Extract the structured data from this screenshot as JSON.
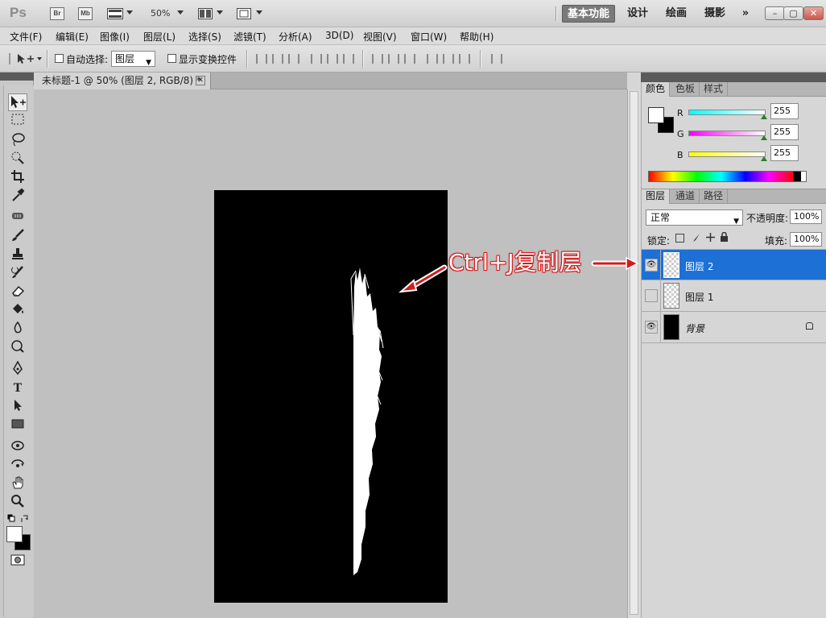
{
  "app": {
    "logo": "Ps",
    "badges": [
      "Br",
      "Mb"
    ],
    "zoom": "50%",
    "workspaces": [
      {
        "label": "基本功能",
        "active": true
      },
      {
        "label": "设计",
        "active": false
      },
      {
        "label": "绘画",
        "active": false
      },
      {
        "label": "摄影",
        "active": false
      }
    ],
    "more": "»",
    "window_buttons": {
      "minimize": "–",
      "restore": "▢",
      "close": "✕"
    }
  },
  "menu": [
    "文件(F)",
    "编辑(E)",
    "图像(I)",
    "图层(L)",
    "选择(S)",
    "滤镜(T)",
    "分析(A)",
    "3D(D)",
    "视图(V)",
    "窗口(W)",
    "帮助(H)"
  ],
  "options": {
    "auto_select_label": "自动选择:",
    "auto_select_value": "图层",
    "show_transform_label": "显示变换控件"
  },
  "document": {
    "tab_title": "未标题-1 @ 50% (图层 2, RGB/8) *",
    "close": "✕"
  },
  "annotation": {
    "text": "Ctrl+J复制层",
    "color": "#d31b1b"
  },
  "color_panel": {
    "tabs": [
      "颜色",
      "色板",
      "样式"
    ],
    "channels": [
      {
        "label": "R",
        "value": "255"
      },
      {
        "label": "G",
        "value": "255"
      },
      {
        "label": "B",
        "value": "255"
      }
    ]
  },
  "layers_panel": {
    "tabs": [
      "图层",
      "通道",
      "路径"
    ],
    "blend_mode": "正常",
    "opacity_label": "不透明度:",
    "opacity": "100%",
    "lock_label": "锁定:",
    "fill_label": "填充:",
    "fill": "100%",
    "layers": [
      {
        "name": "图层 2",
        "visible": true,
        "selected": true,
        "locked": false
      },
      {
        "name": "图层 1",
        "visible": false,
        "selected": false,
        "locked": false
      },
      {
        "name": "背景",
        "visible": true,
        "selected": false,
        "locked": true
      }
    ]
  },
  "colors": {
    "selection": "#1c70d6",
    "canvas": "#000000",
    "annotation": "#d31b1b"
  }
}
